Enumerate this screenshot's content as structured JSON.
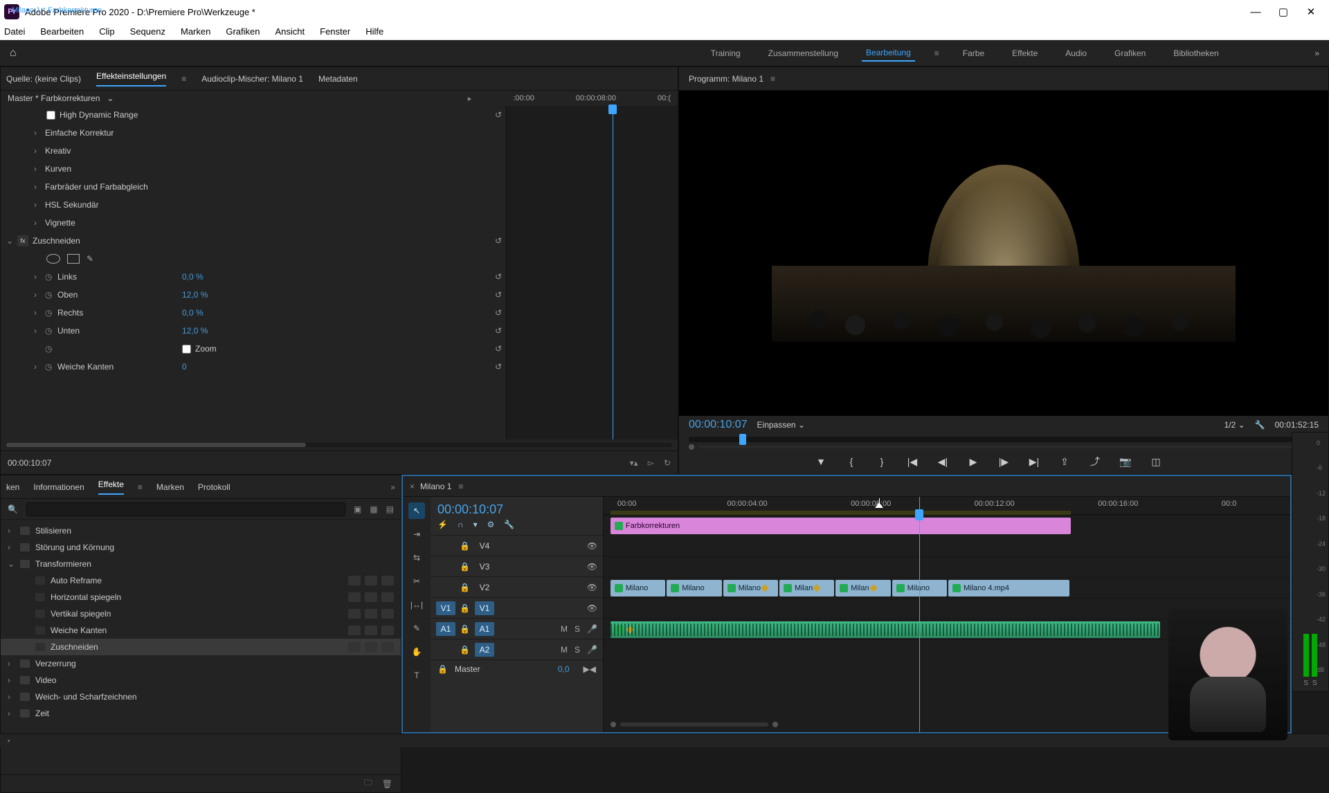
{
  "window": {
    "title": "Adobe Premiere Pro 2020 - D:\\Premiere Pro\\Werkzeuge *",
    "logo": "Pr"
  },
  "menu": [
    "Datei",
    "Bearbeiten",
    "Clip",
    "Sequenz",
    "Marken",
    "Grafiken",
    "Ansicht",
    "Fenster",
    "Hilfe"
  ],
  "workspaces": [
    "Training",
    "Zusammenstellung",
    "Bearbeitung",
    "Farbe",
    "Effekte",
    "Audio",
    "Grafiken",
    "Bibliotheken"
  ],
  "workspace_active": "Bearbeitung",
  "source_panel_tabs": [
    "Quelle: (keine Clips)",
    "Effekteinstellungen",
    "Audioclip-Mischer: Milano 1",
    "Metadaten"
  ],
  "source_active": "Effekteinstellungen",
  "ec": {
    "master": "Master * Farbkorrekturen",
    "clip": "Milano 1 * Farbkorrekturen",
    "mini_tc": [
      ":00:00",
      "00:00:08:00",
      "00:("
    ],
    "hdr": "High Dynamic Range",
    "groups": [
      "Einfache Korrektur",
      "Kreativ",
      "Kurven",
      "Farbräder und Farbabgleich",
      "HSL Sekundär",
      "Vignette"
    ],
    "crop_name": "Zuschneiden",
    "props": {
      "links": {
        "label": "Links",
        "val": "0,0 %"
      },
      "oben": {
        "label": "Oben",
        "val": "12,0 %"
      },
      "rechts": {
        "label": "Rechts",
        "val": "0,0 %"
      },
      "unten": {
        "label": "Unten",
        "val": "12,0 %"
      },
      "zoom": {
        "label": "Zoom"
      },
      "kanten": {
        "label": "Weiche Kanten",
        "val": "0"
      }
    },
    "tc": "00:00:10:07"
  },
  "program": {
    "title": "Programm: Milano 1",
    "tc": "00:00:10:07",
    "fit": "Einpassen",
    "res": "1/2",
    "dur": "00:01:52:15"
  },
  "fx": {
    "tabs": [
      "ken",
      "Informationen",
      "Effekte",
      "Marken",
      "Protokoll"
    ],
    "active": "Effekte",
    "search_ph": "",
    "nodes": {
      "stilisieren": "Stilisieren",
      "storung": "Störung und Körnung",
      "transform": "Transformieren",
      "verzerrung": "Verzerrung",
      "video": "Video",
      "weich": "Weich- und Scharfzeichnen",
      "zeit": "Zeit"
    },
    "leaves": {
      "autoreframe": "Auto Reframe",
      "hspiegeln": "Horizontal spiegeln",
      "vspiegeln": "Vertikal spiegeln",
      "kanten": "Weiche Kanten",
      "zuschneiden": "Zuschneiden"
    }
  },
  "tl": {
    "seq": "Milano 1",
    "tc": "00:00:10:07",
    "ruler": [
      "00:00",
      "00:00:04:00",
      "00:00:08:00",
      "00:00:12:00",
      "00:00:16:00",
      "00:0"
    ],
    "tracks": {
      "v4": "V4",
      "v3": "V3",
      "v2": "V2",
      "v1": "V1",
      "a1": "A1",
      "a2": "A2"
    },
    "src": {
      "v1": "V1",
      "a1": "A1"
    },
    "master": "Master",
    "master_val": "0,0",
    "adj": "Farbkorrekturen",
    "clips": [
      "Milano",
      "Milano",
      "Milano",
      "Milan",
      "Milan",
      "Milano",
      "Milano 4.mp4"
    ],
    "mute": "M",
    "solo": "S",
    "rec": "●"
  },
  "meter_ticks": [
    "0",
    "-6",
    "-12",
    "-18",
    "-24",
    "-30",
    "-36",
    "-42",
    "-48",
    "dB"
  ]
}
